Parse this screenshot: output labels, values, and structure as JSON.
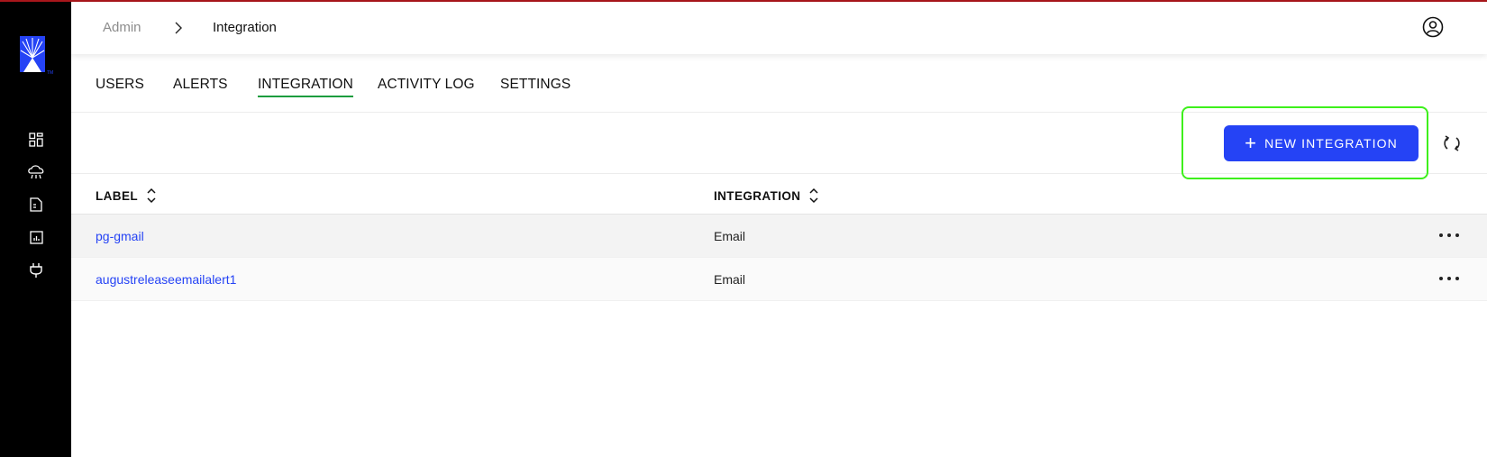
{
  "breadcrumb": {
    "root": "Admin",
    "current": "Integration"
  },
  "tabs": [
    {
      "label": "USERS",
      "active": false
    },
    {
      "label": "ALERTS",
      "active": false
    },
    {
      "label": "INTEGRATION",
      "active": true
    },
    {
      "label": "ACTIVITY LOG",
      "active": false
    },
    {
      "label": "SETTINGS",
      "active": false
    }
  ],
  "toolbar": {
    "new_integration_label": "NEW INTEGRATION"
  },
  "table": {
    "columns": [
      "LABEL",
      "INTEGRATION"
    ],
    "rows": [
      {
        "label": "pg-gmail",
        "integration": "Email"
      },
      {
        "label": "augustreleaseemailalert1",
        "integration": "Email"
      }
    ]
  },
  "sidebar": {
    "icons": [
      "dashboard-icon",
      "cloud-icon",
      "document-icon",
      "report-icon",
      "plug-icon"
    ]
  },
  "colors": {
    "accent": "#2543f5",
    "active_tab_underline": "#1a9c3e",
    "highlight": "#3ef01c",
    "sidebar_bg": "#000000"
  }
}
